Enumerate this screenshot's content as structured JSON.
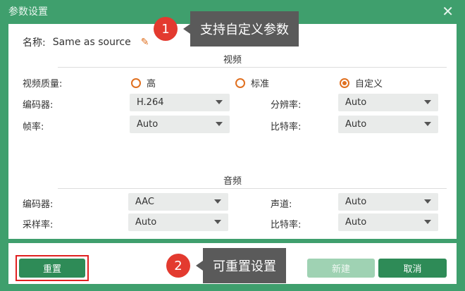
{
  "window": {
    "title": "参数设置",
    "close_icon": "close-icon"
  },
  "name_row": {
    "label": "名称:",
    "value": "Same as source"
  },
  "video": {
    "section_title": "视频",
    "quality_label": "视频质量:",
    "quality_options": [
      "高",
      "标准",
      "自定义"
    ],
    "quality_selected": "自定义",
    "encoder_label": "编码器:",
    "encoder_value": "H.264",
    "resolution_label": "分辨率:",
    "resolution_value": "Auto",
    "framerate_label": "帧率:",
    "framerate_value": "Auto",
    "bitrate_label": "比特率:",
    "bitrate_value": "Auto"
  },
  "audio": {
    "section_title": "音频",
    "encoder_label": "编码器:",
    "encoder_value": "AAC",
    "channel_label": "声道:",
    "channel_value": "Auto",
    "samplerate_label": "采样率:",
    "samplerate_value": "Auto",
    "bitrate_label": "比特率:",
    "bitrate_value": "Auto"
  },
  "buttons": {
    "reset": "重置",
    "new": "新建",
    "cancel": "取消"
  },
  "annotations": {
    "badge1": "1",
    "tip1": "支持自定义参数",
    "badge2": "2",
    "tip2": "可重置设置"
  },
  "colors": {
    "accent": "#2e8b57",
    "radio": "#e07020",
    "badge": "#e33a2f"
  }
}
